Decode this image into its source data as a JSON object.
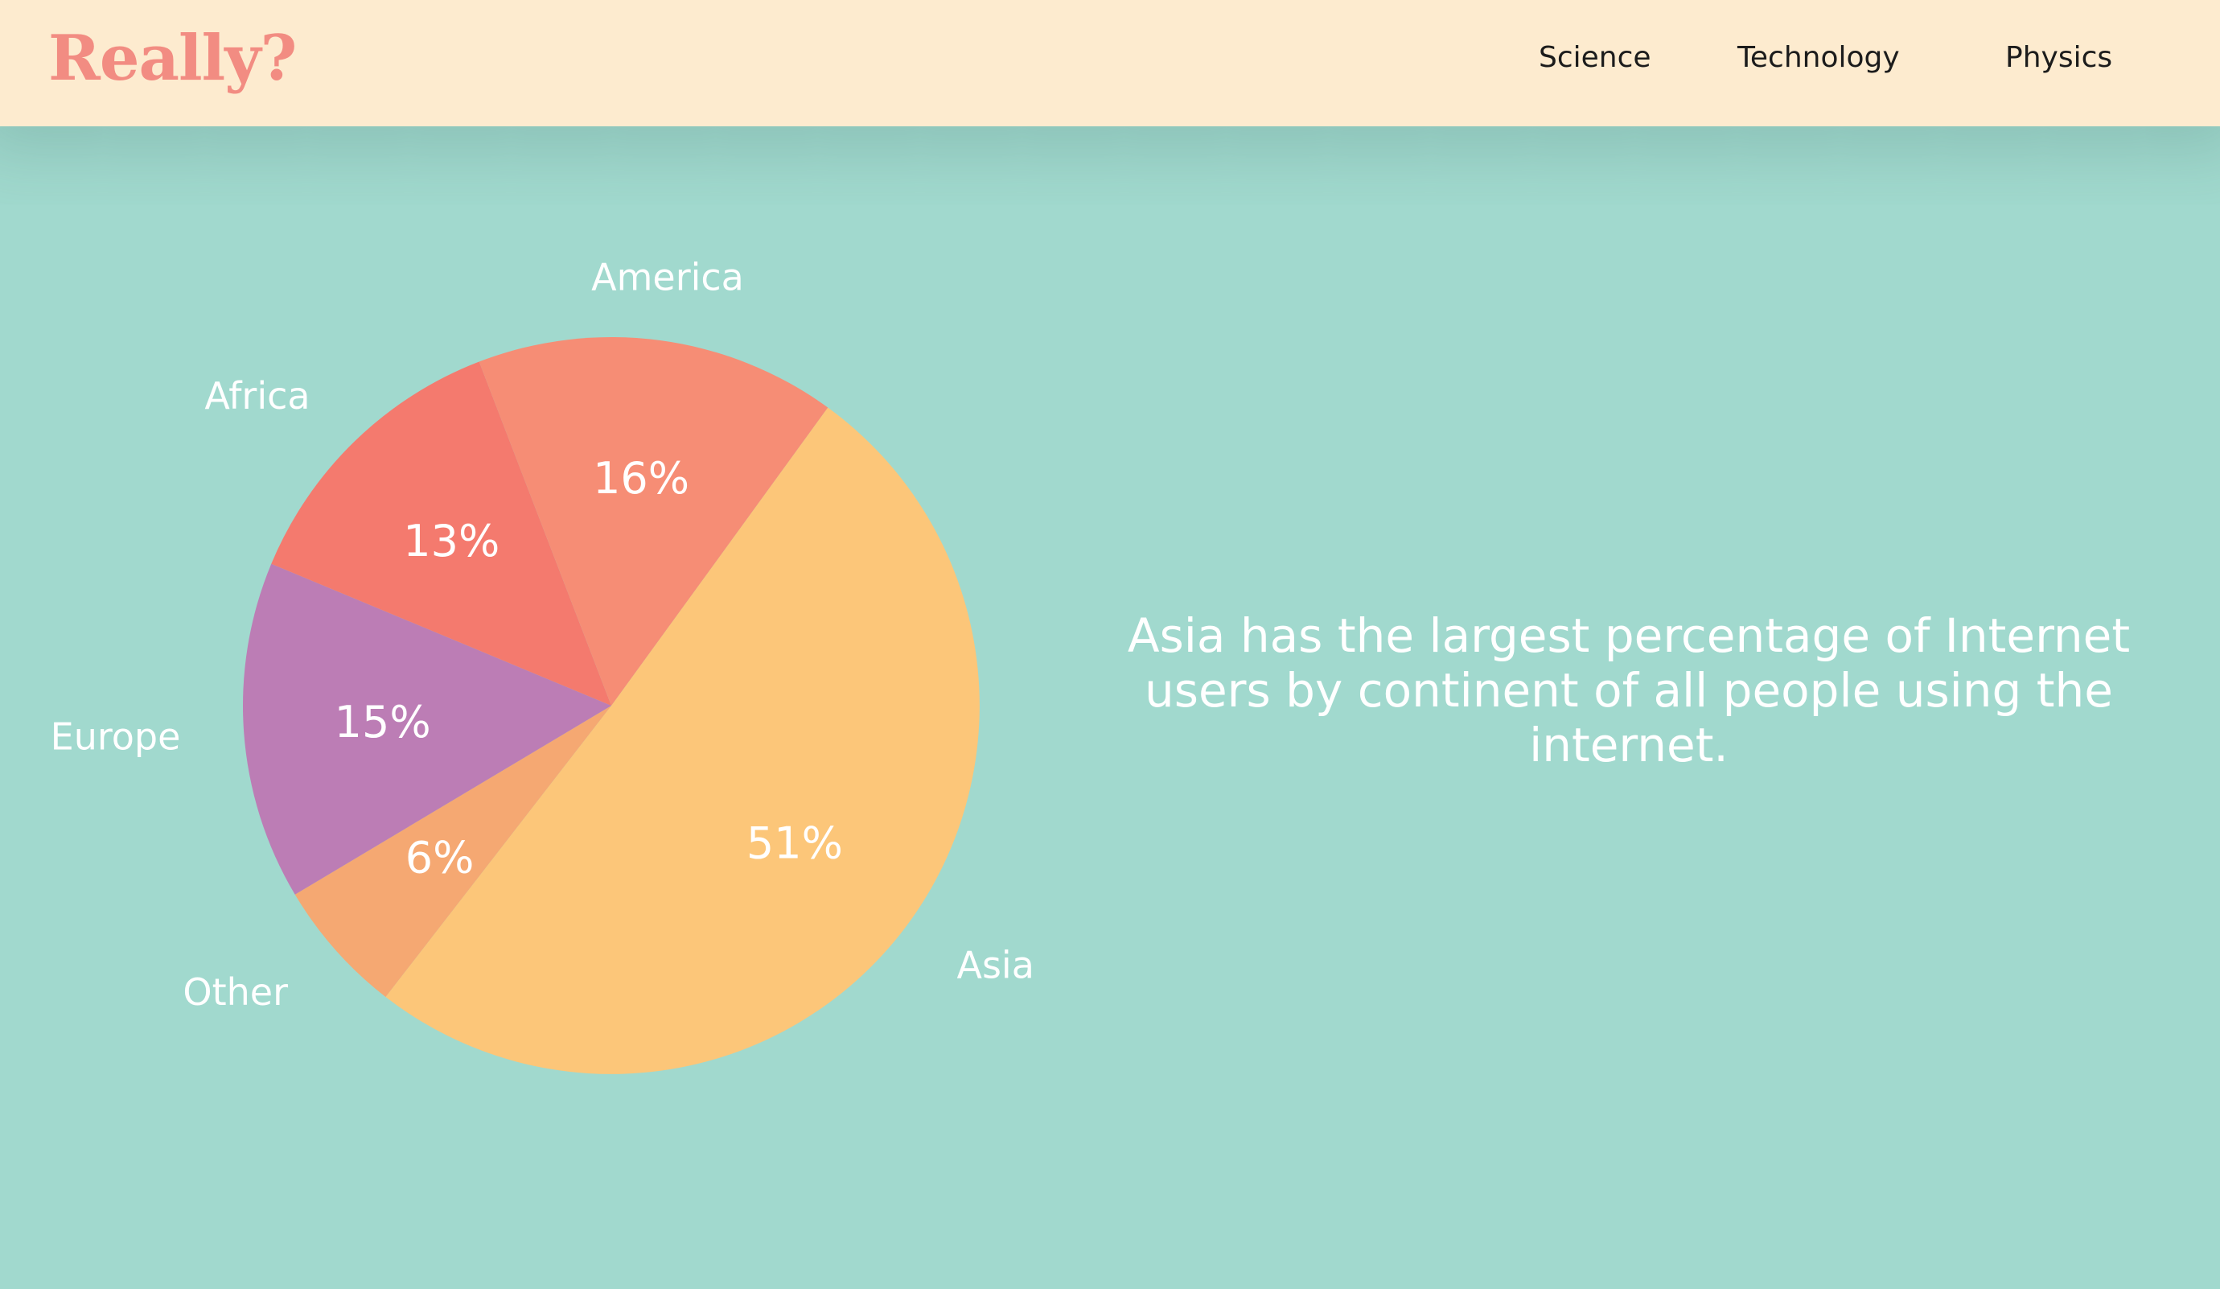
{
  "header": {
    "logo": "Really?",
    "nav": [
      {
        "label": "Science"
      },
      {
        "label": "Technology"
      },
      {
        "label": "Physics"
      }
    ]
  },
  "caption": "Asia has the largest percentage of Internet users by continent of all people using the internet.",
  "chart_data": {
    "type": "pie",
    "title": "",
    "start_angle_deg": 36,
    "direction": "clockwise",
    "slices": [
      {
        "label": "Asia",
        "value": 51,
        "value_label": "51%",
        "color": "#fcc679"
      },
      {
        "label": "Other",
        "value": 6,
        "value_label": "6%",
        "color": "#f5a872"
      },
      {
        "label": "Europe",
        "value": 15,
        "value_label": "15%",
        "color": "#bc7db5"
      },
      {
        "label": "Africa",
        "value": 13,
        "value_label": "13%",
        "color": "#f47a6e"
      },
      {
        "label": "America",
        "value": 16,
        "value_label": "16%",
        "color": "#f68d75"
      }
    ]
  },
  "colors": {
    "header_bg": "#fdebcf",
    "page_bg": "#a1d9ce",
    "logo": "#f28c82",
    "text_light": "#ffffff"
  }
}
